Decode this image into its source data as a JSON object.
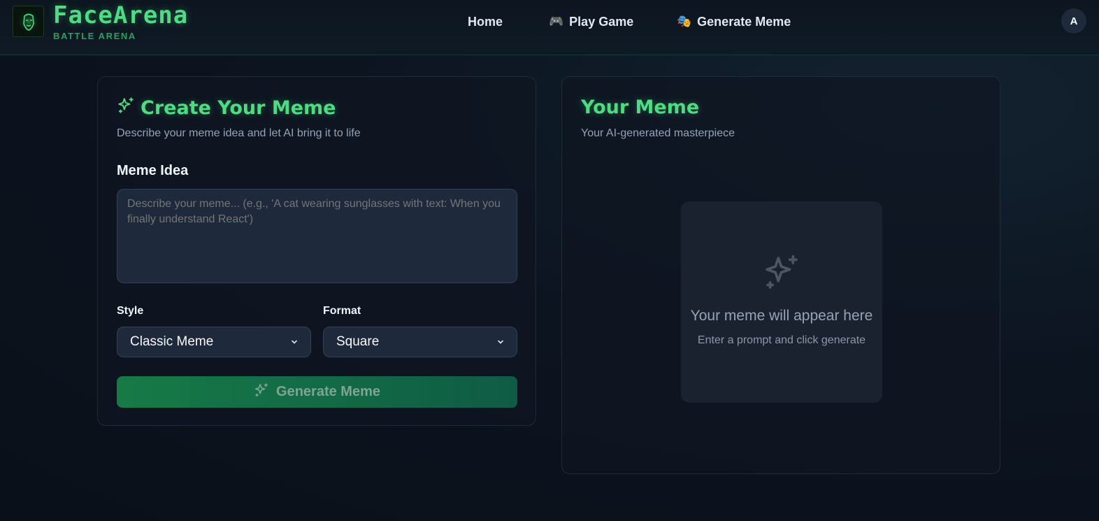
{
  "brand": {
    "name": "FaceArena",
    "tagline": "BATTLE ARENA"
  },
  "nav": {
    "items": [
      {
        "label": "Home",
        "icon": ""
      },
      {
        "label": "Play Game",
        "icon": "🎮"
      },
      {
        "label": "Generate Meme",
        "icon": "🎭"
      }
    ]
  },
  "user": {
    "avatar_initial": "A"
  },
  "create_card": {
    "title": "Create Your Meme",
    "subtitle": "Describe your meme idea and let AI bring it to life",
    "idea_label": "Meme Idea",
    "idea_placeholder": "Describe your meme... (e.g., 'A cat wearing sunglasses with text: When you finally understand React')",
    "idea_value": "",
    "style_label": "Style",
    "style_value": "Classic Meme",
    "format_label": "Format",
    "format_value": "Square",
    "generate_label": "Generate Meme"
  },
  "result_card": {
    "title": "Your Meme",
    "subtitle": "Your AI-generated masterpiece",
    "placeholder_title": "Your meme will appear here",
    "placeholder_sub": "Enter a prompt and click generate"
  },
  "colors": {
    "accent": "#4ade80",
    "button_gradient_start": "#167a46",
    "button_gradient_end": "#0f5c45",
    "background": "#0b111c"
  },
  "icons": {
    "logo": "face-logo-icon",
    "sparkles": "sparkles-icon",
    "chevron": "chevron-down-icon"
  }
}
